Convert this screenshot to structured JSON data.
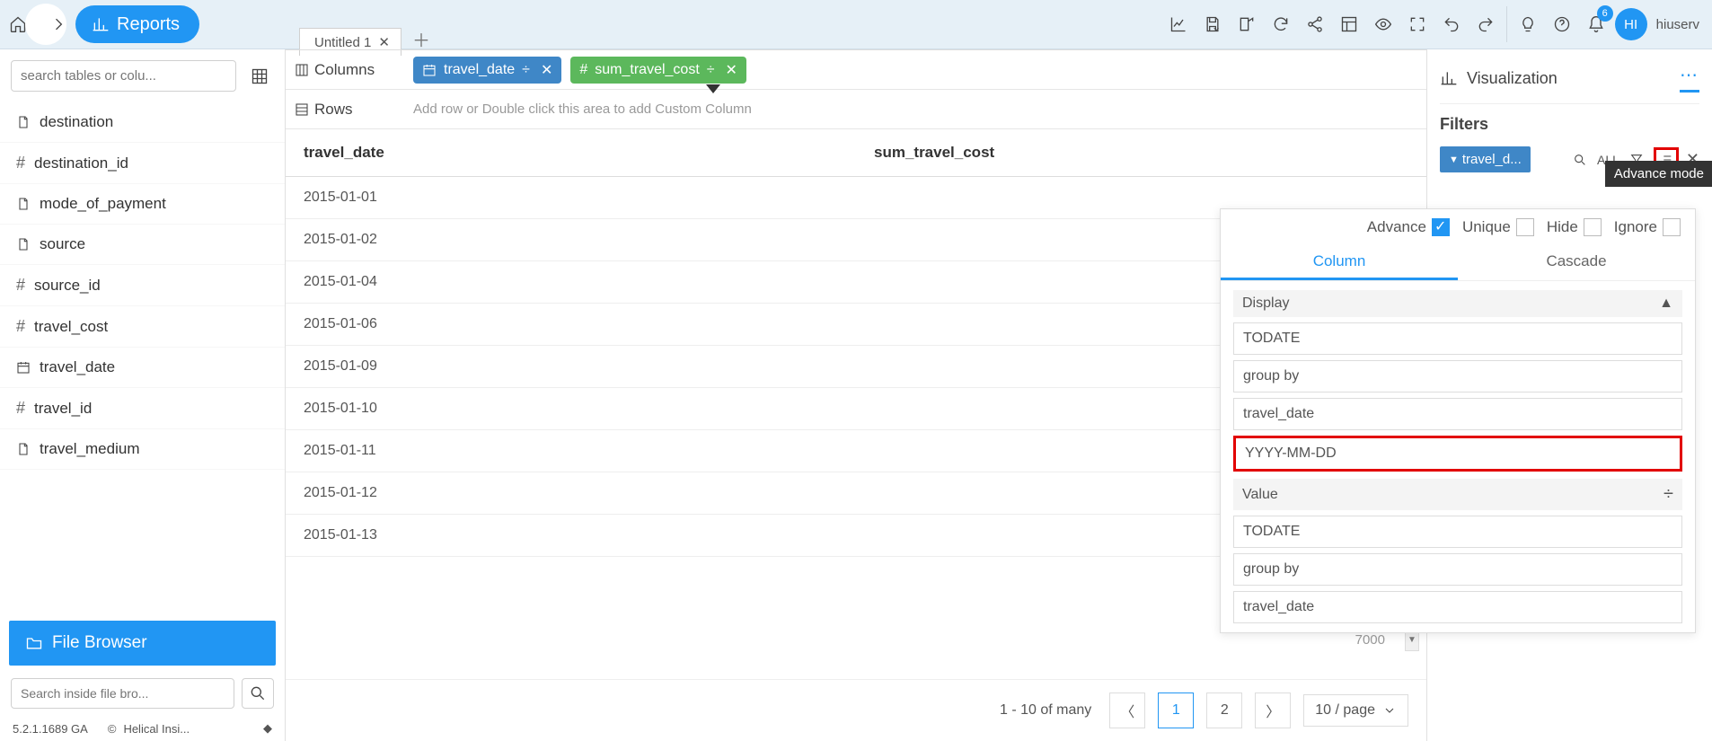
{
  "topbar": {
    "reports_label": "Reports",
    "notif_count": "6",
    "avatar_initials": "HI",
    "username": "hiuserv"
  },
  "tabs": {
    "items": [
      {
        "label": "Untitled 1"
      }
    ]
  },
  "sidebar": {
    "search_placeholder": "search tables or colu...",
    "fields": [
      {
        "name": "destination",
        "kind": "text"
      },
      {
        "name": "destination_id",
        "kind": "number"
      },
      {
        "name": "mode_of_payment",
        "kind": "text"
      },
      {
        "name": "source",
        "kind": "text"
      },
      {
        "name": "source_id",
        "kind": "number"
      },
      {
        "name": "travel_cost",
        "kind": "number"
      },
      {
        "name": "travel_date",
        "kind": "date"
      },
      {
        "name": "travel_id",
        "kind": "number"
      },
      {
        "name": "travel_medium",
        "kind": "text"
      }
    ],
    "file_browser_label": "File Browser",
    "fb_search_placeholder": "Search inside file bro...",
    "version": "5.2.1.1689 GA",
    "brand": "Helical Insi..."
  },
  "shelves": {
    "columns_label": "Columns",
    "rows_label": "Rows",
    "column_pills": [
      {
        "label": "travel_date",
        "color": "blue"
      },
      {
        "label": "sum_travel_cost",
        "color": "green"
      }
    ],
    "rows_placeholder": "Add row or Double click this area to add Custom Column"
  },
  "table": {
    "headers": [
      "travel_date",
      "sum_travel_cost"
    ],
    "rows": [
      [
        "2015-01-01",
        ""
      ],
      [
        "2015-01-02",
        ""
      ],
      [
        "2015-01-04",
        ""
      ],
      [
        "2015-01-06",
        ""
      ],
      [
        "2015-01-09",
        ""
      ],
      [
        "2015-01-10",
        ""
      ],
      [
        "2015-01-11",
        ""
      ],
      [
        "2015-01-12",
        ""
      ],
      [
        "2015-01-13",
        ""
      ]
    ],
    "ghost_value": "7000"
  },
  "pager": {
    "info": "1 - 10 of many",
    "pages": [
      "1",
      "2"
    ],
    "active": "1",
    "per_page": "10 / page"
  },
  "rightpanel": {
    "viz_label": "Visualization",
    "filters_label": "Filters",
    "adv_tooltip": "Advance mode",
    "filter_chip": "travel_d...",
    "all_label": "ALL"
  },
  "popup": {
    "advance_label": "Advance",
    "unique_label": "Unique",
    "hide_label": "Hide",
    "ignore_label": "Ignore",
    "tabs": {
      "column": "Column",
      "cascade": "Cascade"
    },
    "display_label": "Display",
    "display_fields": [
      "TODATE",
      "group by",
      "travel_date",
      "YYYY-MM-DD"
    ],
    "value_label": "Value",
    "value_fields": [
      "TODATE",
      "group by",
      "travel_date"
    ]
  }
}
